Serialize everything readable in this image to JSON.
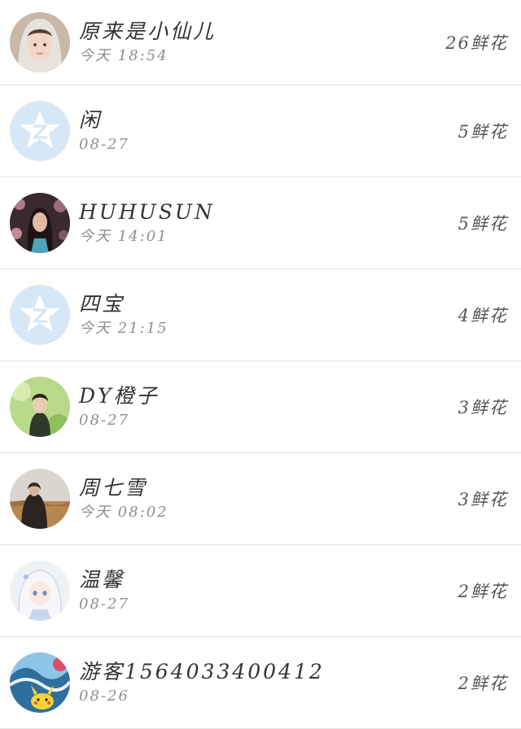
{
  "rows": [
    {
      "name": "原来是小仙儿",
      "time": "今天 18:54",
      "flowers": "26鲜花",
      "avatar": "photo-girl-headscarf"
    },
    {
      "name": "闲",
      "time": "08-27",
      "flowers": "5鲜花",
      "avatar": "default-qq-star"
    },
    {
      "name": "HUHUSUN",
      "time": "今天 14:01",
      "flowers": "5鲜花",
      "avatar": "photo-woman-flowers"
    },
    {
      "name": "四宝",
      "time": "今天 21:15",
      "flowers": "4鲜花",
      "avatar": "default-qq-star"
    },
    {
      "name": "DY橙子",
      "time": "08-27",
      "flowers": "3鲜花",
      "avatar": "photo-boy-green"
    },
    {
      "name": "周七雪",
      "time": "今天 08:02",
      "flowers": "3鲜花",
      "avatar": "photo-woman-field"
    },
    {
      "name": "温馨",
      "time": "08-27",
      "flowers": "2鲜花",
      "avatar": "anime-girl-white-hair"
    },
    {
      "name": "游客1564033400412",
      "time": "08-26",
      "flowers": "2鲜花",
      "avatar": "pikachu-wave"
    }
  ]
}
